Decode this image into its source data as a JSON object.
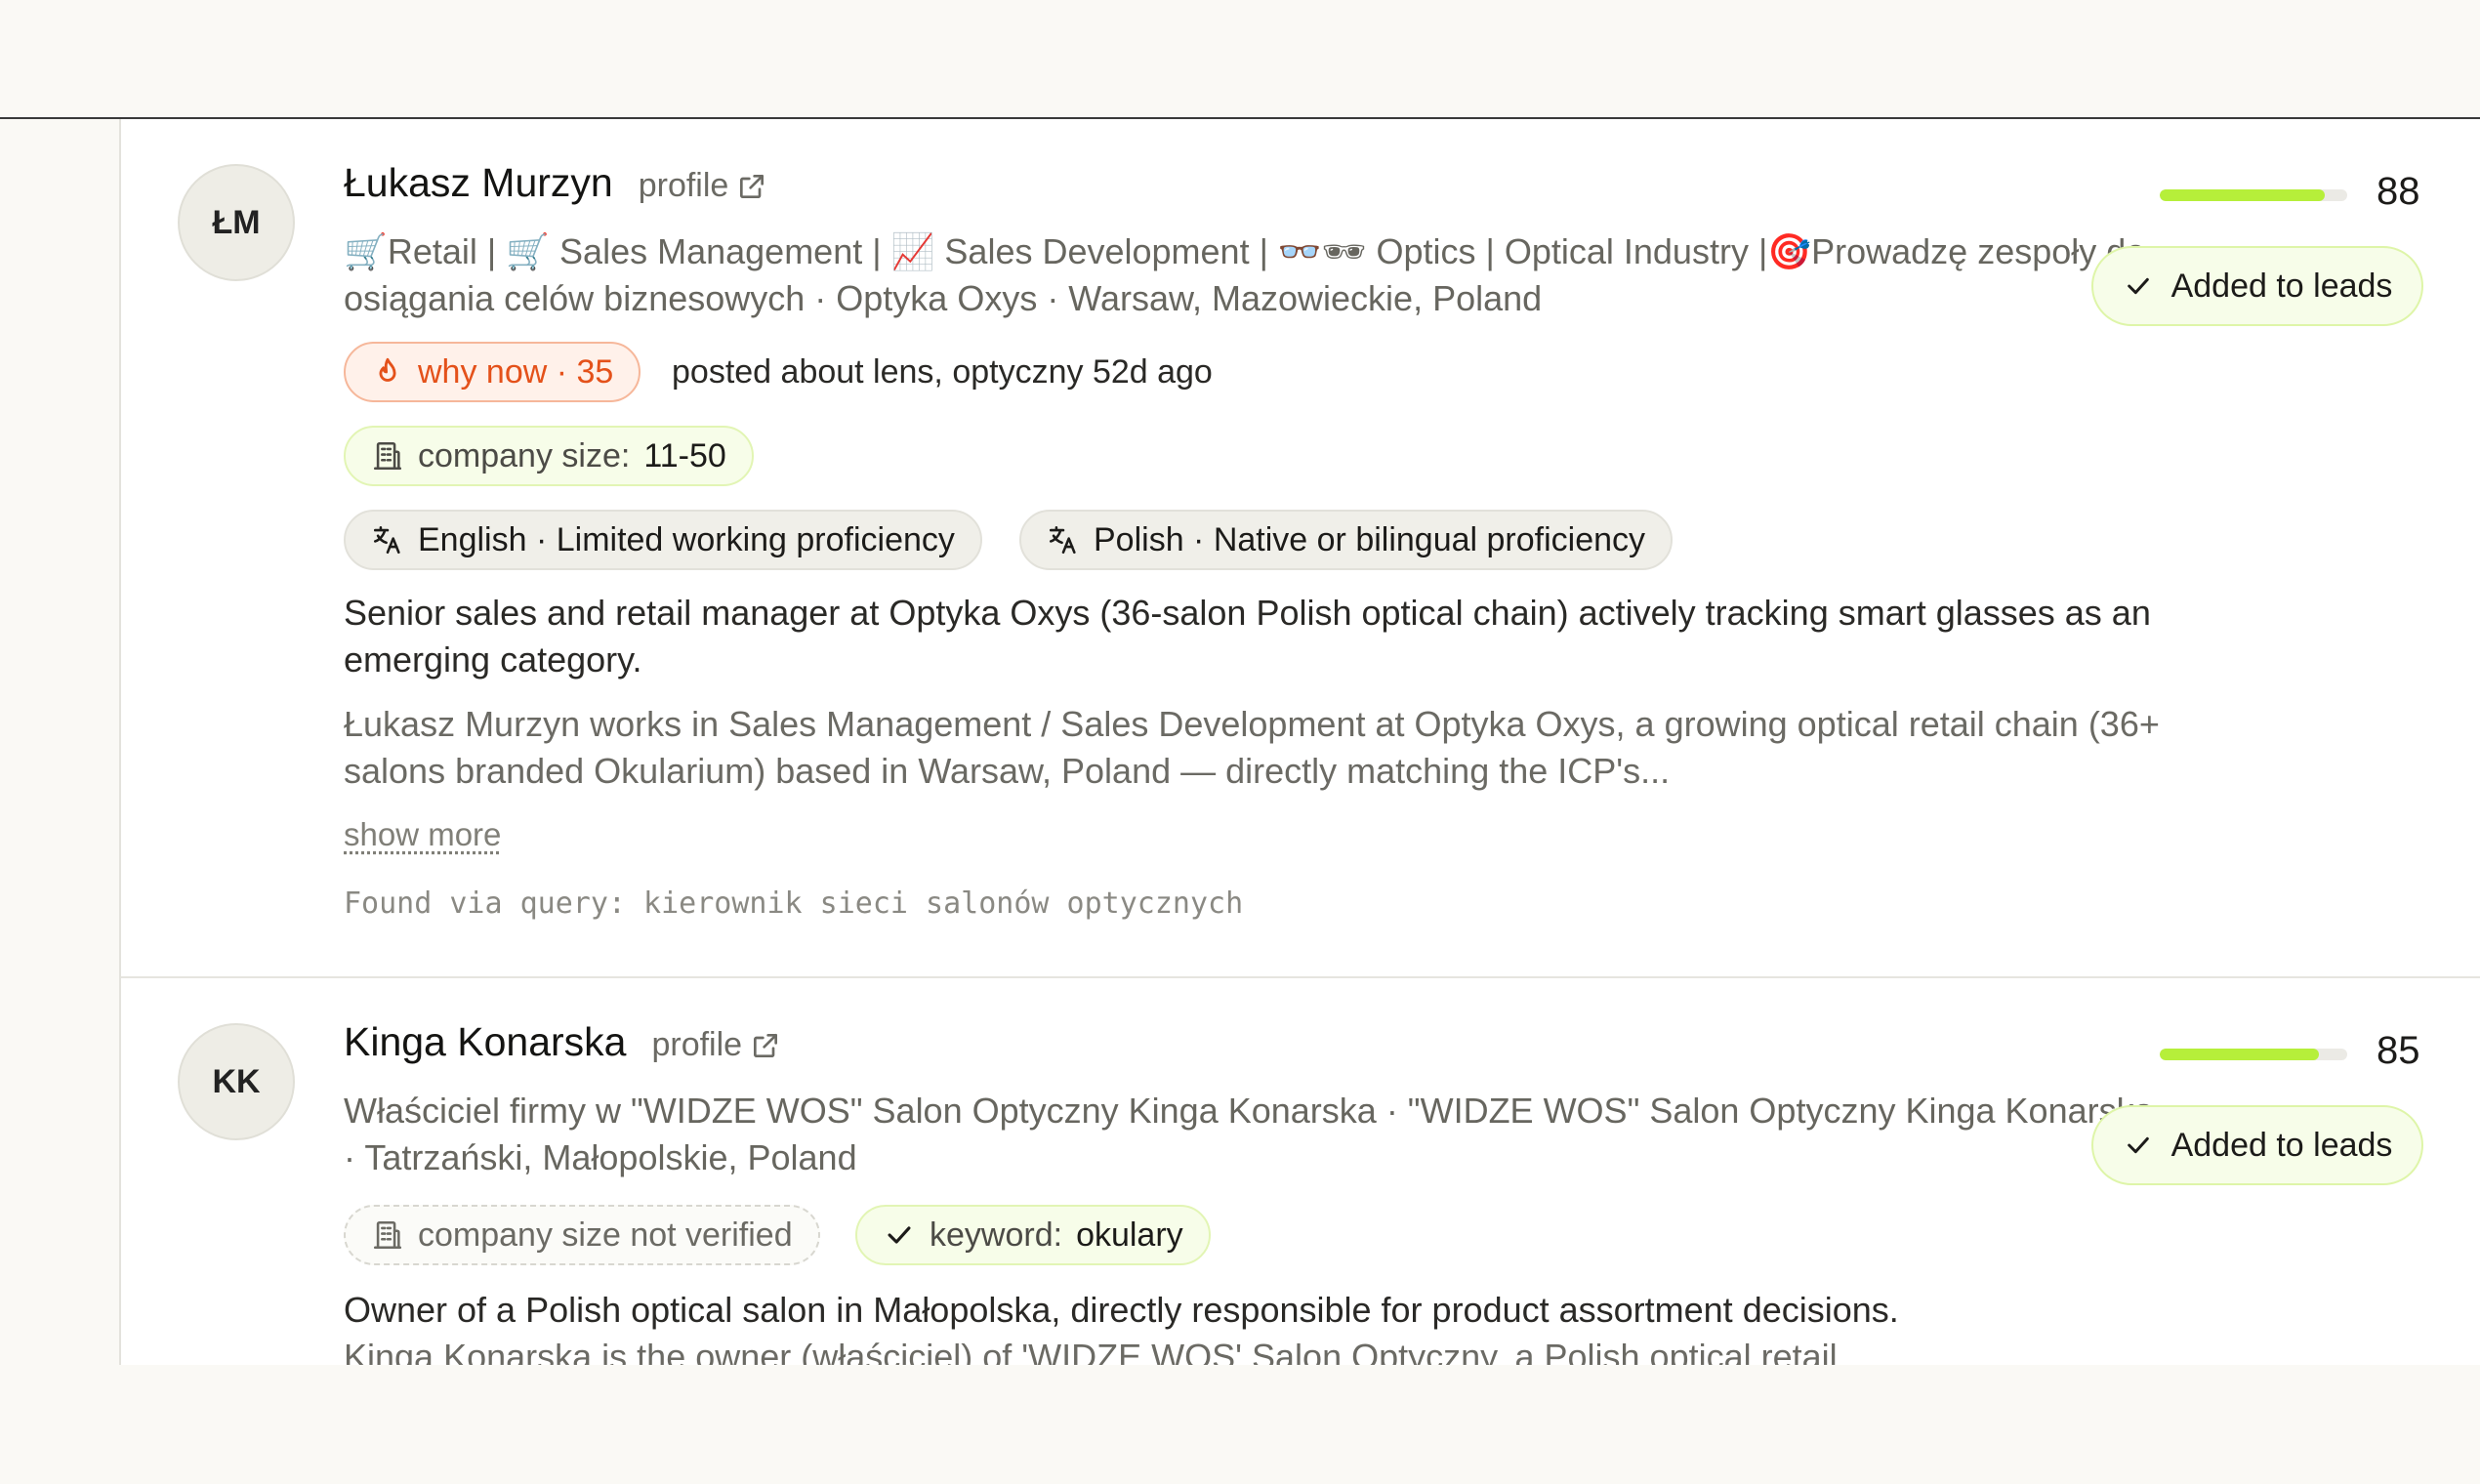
{
  "candidates": [
    {
      "initials": "ŁM",
      "name": "Łukasz Murzyn",
      "profile_label": "profile",
      "headline": "🛒Retail | 🛒 Sales Management | 📈 Sales Development | 👓🕶 Optics | Optical Industry |🎯Prowadzę zespoły do osiągania celów biznesowych · Optyka Oxys · Warsaw, Mazowieckie, Poland",
      "why_now": "why now · 35",
      "why_now_text": "posted about lens, optyczny 52d ago",
      "company_size_label": "company size:",
      "company_size_value": "11-50",
      "languages": [
        "English · Limited working proficiency",
        "Polish · Native or bilingual proficiency"
      ],
      "summary": "Senior sales and retail manager at Optyka Oxys (36-salon Polish optical chain) actively tracking smart glasses as an emerging category.",
      "detail": "Łukasz Murzyn works in Sales Management / Sales Development at Optyka Oxys, a growing optical retail chain (36+ salons branded Okularium) based in Warsaw, Poland — directly matching the ICP's...",
      "show_more": "show more",
      "query": "Found via query: kierownik sieci salonów optycznych",
      "score": 88,
      "score_fraction": 0.88,
      "leads_label": "Added to leads"
    },
    {
      "initials": "KK",
      "name": "Kinga Konarska",
      "profile_label": "profile",
      "headline": "Właściciel firmy w \"WIDZE WOS\" Salon Optyczny Kinga Konarska · \"WIDZE WOS\" Salon Optyczny Kinga Konarska · Tatrzański, Małopolskie, Poland",
      "company_size_unverified": "company size not verified",
      "keyword_label": "keyword:",
      "keyword_value": "okulary",
      "summary": "Owner of a Polish optical salon in Małopolska, directly responsible for product assortment decisions.",
      "detail": "Kinga Konarska is the owner (właściciel) of 'WIDZE WOS' Salon Optyczny, a Polish optical retail",
      "score": 85,
      "score_fraction": 0.85,
      "leads_label": "Added to leads"
    }
  ],
  "colors": {
    "accent_lime": "#b6ef3a",
    "why_now_orange": "#e4511a"
  },
  "icons": [
    "external-link-icon",
    "flame-icon",
    "building-icon",
    "translate-icon",
    "check-icon"
  ]
}
